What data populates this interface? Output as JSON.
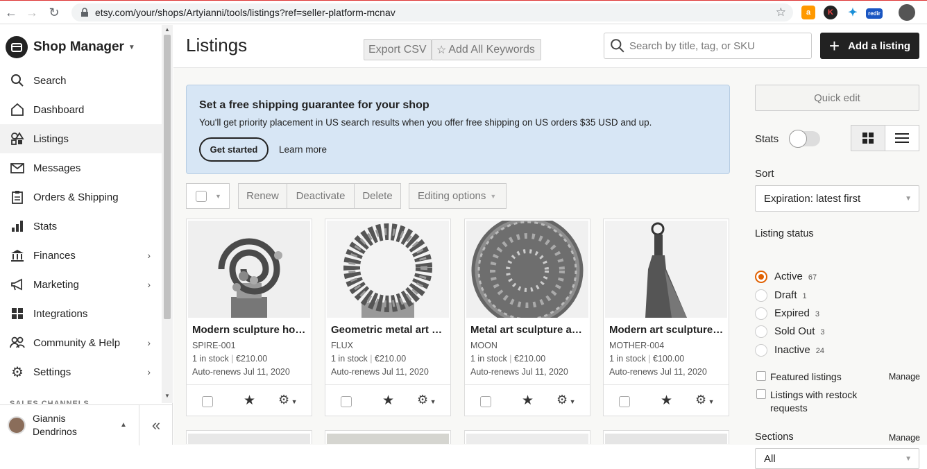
{
  "browser": {
    "url": "etsy.com/your/shops/Artyianni/tools/listings?ref=seller-platform-mcnav",
    "ext_redir_label": "redir"
  },
  "sidebar": {
    "brand_title": "Shop Manager",
    "items": [
      {
        "label": "Search",
        "icon": "search-icon"
      },
      {
        "label": "Dashboard",
        "icon": "home-icon"
      },
      {
        "label": "Listings",
        "icon": "shapes-icon"
      },
      {
        "label": "Messages",
        "icon": "mail-icon"
      },
      {
        "label": "Orders & Shipping",
        "icon": "clipboard-icon"
      },
      {
        "label": "Stats",
        "icon": "bar-chart-icon"
      },
      {
        "label": "Finances",
        "icon": "bank-icon"
      },
      {
        "label": "Marketing",
        "icon": "megaphone-icon"
      },
      {
        "label": "Integrations",
        "icon": "grid-icon"
      },
      {
        "label": "Community & Help",
        "icon": "people-icon"
      },
      {
        "label": "Settings",
        "icon": "gear-icon"
      }
    ],
    "channels_label": "SALES CHANNELS",
    "user_name": "Giannis Dendrinos"
  },
  "header": {
    "title": "Listings",
    "export_csv": "Export CSV",
    "add_keywords": "Add All Keywords",
    "search_placeholder": "Search by title, tag, or SKU",
    "add_listing": "Add a listing"
  },
  "banner": {
    "title": "Set a free shipping guarantee for your shop",
    "body": "You'll get priority placement in US search results when you offer free shipping on US orders $35 USD and up.",
    "get_started": "Get started",
    "learn_more": "Learn more"
  },
  "toolbar": {
    "renew": "Renew",
    "deactivate": "Deactivate",
    "delete": "Delete",
    "editing_options": "Editing options"
  },
  "listings": [
    {
      "title": "Modern sculpture home decor",
      "sku": "SPIRE-001",
      "stock": "1 in stock",
      "price": "€210.00",
      "renews": "Auto-renews Jul 11, 2020"
    },
    {
      "title": "Geometric metal art sculpture",
      "sku": "FLUX",
      "stock": "1 in stock",
      "price": "€210.00",
      "renews": "Auto-renews Jul 11, 2020"
    },
    {
      "title": "Metal art sculpture abstract",
      "sku": "MOON",
      "stock": "1 in stock",
      "price": "€210.00",
      "renews": "Auto-renews Jul 11, 2020"
    },
    {
      "title": "Modern art sculpture figure",
      "sku": "MOTHER-004",
      "stock": "1 in stock",
      "price": "€100.00",
      "renews": "Auto-renews Jul 11, 2020"
    }
  ],
  "right_panel": {
    "quick_edit": "Quick edit",
    "stats_label": "Stats",
    "sort_label": "Sort",
    "sort_value": "Expiration: latest first",
    "status_label": "Listing status",
    "statuses": [
      {
        "label": "Active",
        "count": "67",
        "selected": true
      },
      {
        "label": "Draft",
        "count": "1",
        "selected": false
      },
      {
        "label": "Expired",
        "count": "3",
        "selected": false
      },
      {
        "label": "Sold Out",
        "count": "3",
        "selected": false
      },
      {
        "label": "Inactive",
        "count": "24",
        "selected": false
      }
    ],
    "featured": "Featured listings",
    "restock": "Listings with restock requests",
    "manage": "Manage",
    "sections_label": "Sections",
    "sections_value": "All"
  },
  "colors": {
    "accent": "#e06000",
    "banner": "#d7e6f5",
    "dark": "#222222"
  }
}
